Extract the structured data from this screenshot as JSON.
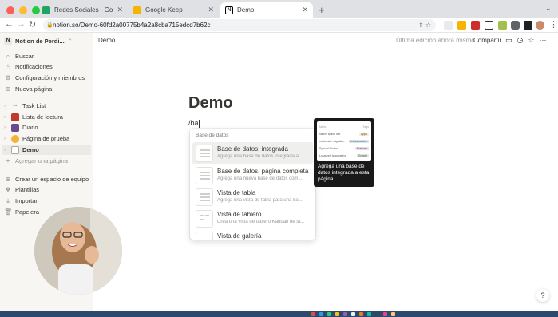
{
  "browser": {
    "tabs": [
      {
        "label": "Redes Sociales - Google Drive",
        "color": "#1fa463",
        "active": false
      },
      {
        "label": "Google Keep",
        "color": "#f6b400",
        "active": false
      },
      {
        "label": "Demo",
        "color": "#000000",
        "active": true
      }
    ],
    "url": "notion.so/Demo-60fd2a00775b4a2a8cba715edcd7b62c"
  },
  "sidebar": {
    "workspace": "Notion de Perdi...",
    "top_items": [
      "Buscar",
      "Notificaciones",
      "Configuración y miembros",
      "Nueva página"
    ],
    "pages": [
      "Task List",
      "Lista de lectura",
      "Diario",
      "Página de prueba",
      "Demo"
    ],
    "add_page": "Agregar una página",
    "bottom_items": [
      "Crear un espacio de equipo",
      "Plantillas",
      "Importar",
      "Papelera"
    ]
  },
  "topbar": {
    "breadcrumb": "Demo",
    "edited": "Última edición ahora mismo",
    "share": "Compartir"
  },
  "page": {
    "title": "Demo",
    "command": "/ba"
  },
  "menu": {
    "header": "Base de datos",
    "items": [
      {
        "title": "Base de datos: integrada",
        "desc": "Agrega una base de datos integrada a ..."
      },
      {
        "title": "Base de datos: página completa",
        "desc": "Agrega una nueva base de datos com..."
      },
      {
        "title": "Vista de tabla",
        "desc": "Agrega una vista de tabla para una ba..."
      },
      {
        "title": "Vista de tablero",
        "desc": "Crea una vista de tablero Kanban de la..."
      },
      {
        "title": "Vista de galería",
        "desc": ""
      }
    ]
  },
  "preview": {
    "text": "Agrega una base de datos integrada a esta página.",
    "header": [
      "Name",
      "Tags"
    ],
    "rows": [
      {
        "name": "Native action bar",
        "tag": "Apps"
      },
      {
        "name": "notion.site migration",
        "tag": "Infrastructure"
      },
      {
        "name": "Synced Blocks",
        "tag": "Platform"
      },
      {
        "name": "Localized typography",
        "tag": "Growth"
      }
    ]
  },
  "help": "?"
}
